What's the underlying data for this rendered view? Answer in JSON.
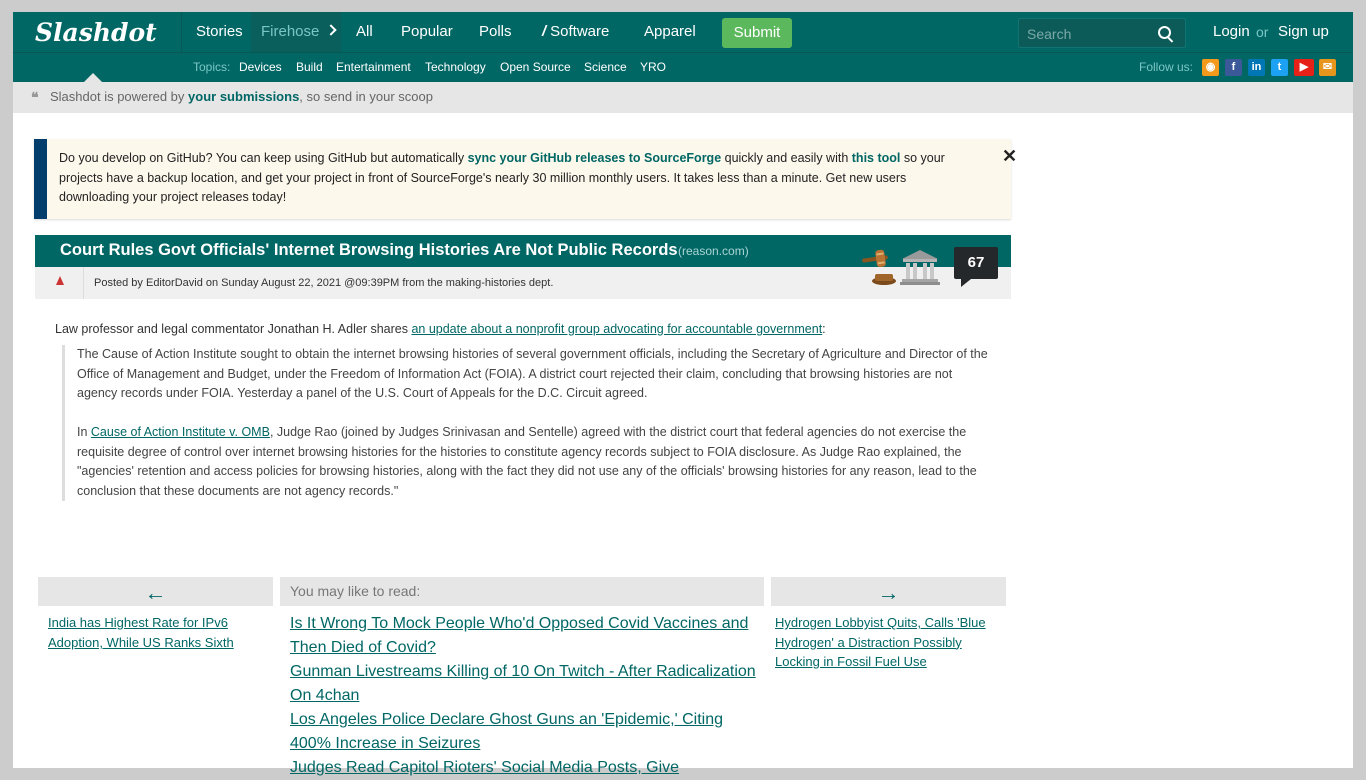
{
  "header": {
    "logo": "Slashdot",
    "nav": [
      "Stories",
      "Firehose",
      "All",
      "Popular",
      "Polls",
      "Software",
      "Apparel"
    ],
    "submit_label": "Submit",
    "search_placeholder": "Search",
    "login": "Login",
    "or": "or",
    "signup": "Sign up"
  },
  "topics": {
    "label": "Topics:",
    "items": [
      "Devices",
      "Build",
      "Entertainment",
      "Technology",
      "Open Source",
      "Science",
      "YRO"
    ],
    "follow_label": "Follow us:"
  },
  "powered": {
    "prefix": "Slashdot is powered by",
    "link": "your submissions",
    "suffix": ", so send in your scoop"
  },
  "banner": {
    "t1": "Do you develop on GitHub? You can keep using GitHub but automatically ",
    "l1": "sync your GitHub releases to SourceForge",
    "t2": " quickly and easily with ",
    "l2": "this tool",
    "t3": " so your projects have a backup location, and get your project in front of SourceForge's nearly 30 million monthly users. It takes less than a minute. Get new users downloading your project releases today!",
    "close": "✕"
  },
  "article": {
    "title": "Court Rules Govt Officials' Internet Browsing Histories Are Not Public Records",
    "source": "(reason.com)",
    "meta": "Posted by EditorDavid on Sunday August 22, 2021 @09:39PM from the making-histories dept.",
    "comments": "67",
    "intro_text": "Law professor and legal commentator Jonathan H. Adler shares ",
    "intro_link": "an update about a nonprofit group advocating for accountable government",
    "intro_end": ":",
    "q1": "The Cause of Action Institute sought to obtain the internet browsing histories of several government officials, including the Secretary of Agriculture and Director of the Office of Management and Budget, under the Freedom of Information Act (FOIA). A district court rejected their claim, concluding that browsing histories are not agency records under FOIA. Yesterday a panel of the U.S. Court of Appeals for the D.C. Circuit agreed.",
    "q2_pre": "In ",
    "q2_link": "Cause of Action Institute v. OMB",
    "q2_post": ", Judge Rao (joined by Judges Srinivasan and Sentelle) agreed with the district court that federal agencies do not exercise the requisite degree of control over internet browsing histories for the histories to constitute agency records subject to FOIA disclosure. As Judge Rao explained, the \"agencies' retention and access policies for browsing histories, along with the fact they did not use any of the officials' browsing histories for any reason, lead to the conclusion that these documents are not agency records.\""
  },
  "bottom": {
    "prev_arrow": "←",
    "prev_link": "India has Highest Rate for IPv6 Adoption, While US Ranks Sixth",
    "may_label": "You may like to read:",
    "may_links": [
      "Is It Wrong To Mock People Who'd Opposed Covid Vaccines and Then Died of Covid?",
      "Gunman Livestreams Killing of 10 On Twitch - After Radicalization On 4chan",
      "Los Angeles Police Declare Ghost Guns an 'Epidemic,' Citing 400% Increase in Seizures",
      "Judges Read Capitol Rioters' Social Media Posts, Give"
    ],
    "next_arrow": "→",
    "next_link": "Hydrogen Lobbyist Quits, Calls 'Blue Hydrogen' a Distraction Possibly Locking in Fossil Fuel Use"
  }
}
